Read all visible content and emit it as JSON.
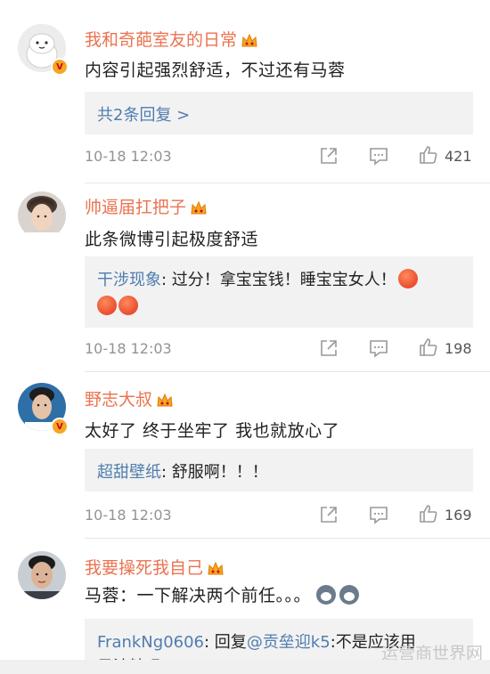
{
  "comments": [
    {
      "username": "我和奇葩室友的日常",
      "text": "内容引起强烈舒适，不过还有马蓉",
      "more_replies": "共2条回复 >",
      "time": "10-18 12:03",
      "likes": "421",
      "verified": true
    },
    {
      "username": "帅逼届扛把子",
      "text": "此条微博引起极度舒适",
      "reply_user": "干涉现象",
      "reply_text": ": 过分！拿宝宝钱！睡宝宝女人！",
      "time": "10-18 12:03",
      "likes": "198",
      "verified": false
    },
    {
      "username": "野志大叔",
      "text": "太好了 终于坐牢了 我也就放心了",
      "reply_user": "超甜壁纸",
      "reply_text": ": 舒服啊！！！",
      "time": "10-18 12:03",
      "likes": "169",
      "verified": true
    },
    {
      "username": "我要操死我自己",
      "text": "马蓉：一下解决两个前任。。。",
      "reply_user": "FrankNg0606",
      "reply_text_a": ": 回复",
      "reply_mention": "@贡垒迎k5",
      "reply_text_b": ":不是应该用",
      "reply_text_line2": "风油精吗",
      "verified": false
    }
  ],
  "watermark": "运营商世界网",
  "colors": {
    "username": "#eb7350",
    "link": "#507daf",
    "reply_bg": "#f2f2f2",
    "meta": "#939393"
  },
  "icons": [
    "crown-icon",
    "share-icon",
    "comment-icon",
    "like-icon",
    "verified-badge",
    "angry-emoji",
    "husky-emoji"
  ]
}
